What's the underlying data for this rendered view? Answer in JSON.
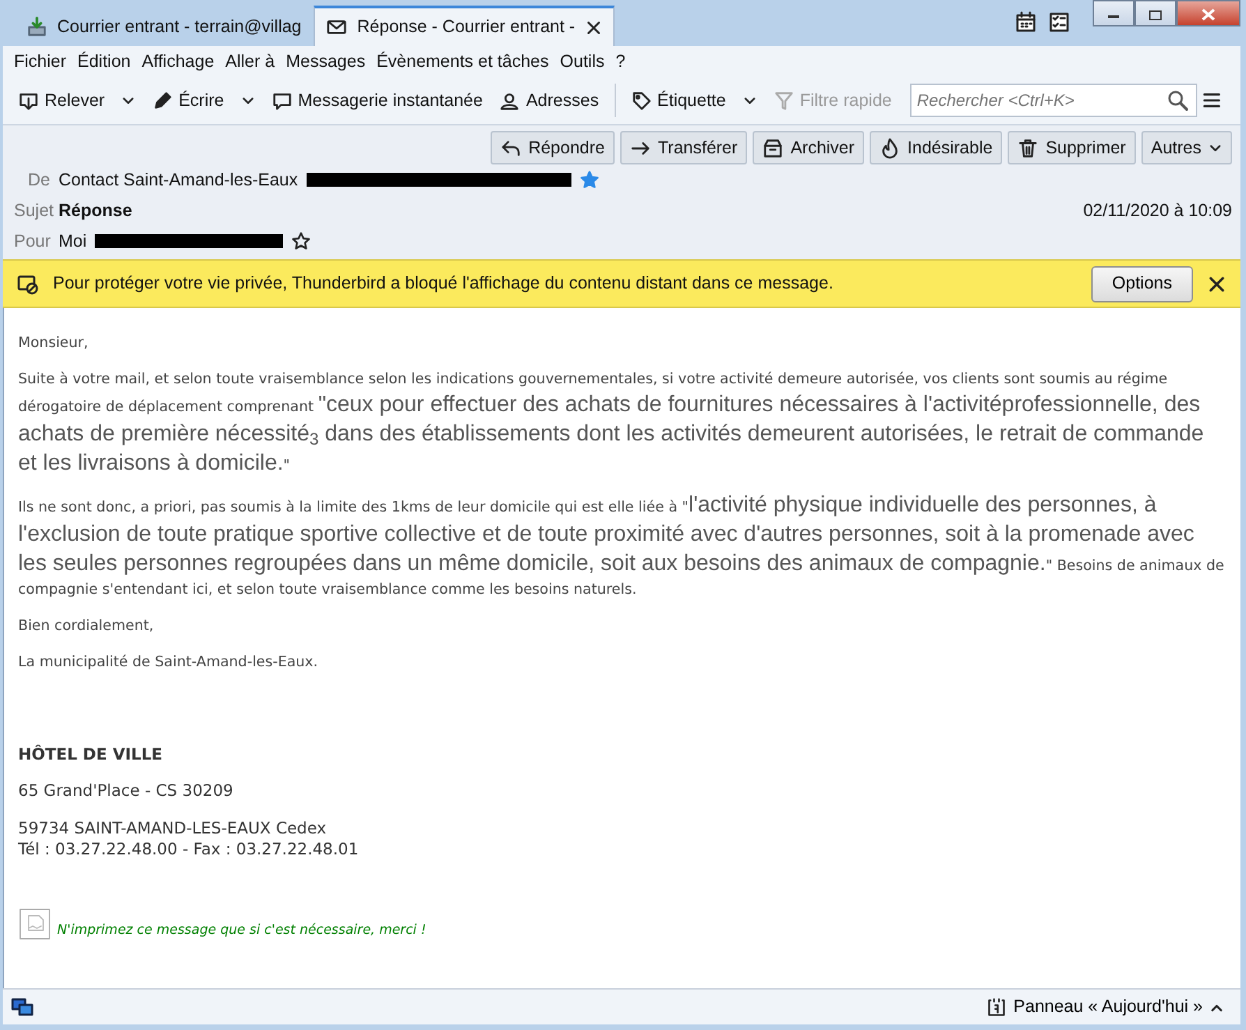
{
  "window": {
    "tabs": [
      {
        "label": "Courrier entrant - terrain@villag",
        "kind": "inbox",
        "selected": false
      },
      {
        "label": "Réponse - Courrier entrant -",
        "kind": "message",
        "selected": true
      }
    ]
  },
  "menu": [
    "Fichier",
    "Édition",
    "Affichage",
    "Aller à",
    "Messages",
    "Évènements et tâches",
    "Outils",
    "?"
  ],
  "toolbar": {
    "buttons": [
      {
        "label": "Relever",
        "kind": "get",
        "dropdown": true,
        "disabled": false
      },
      {
        "label": "Écrire",
        "kind": "write",
        "dropdown": true,
        "disabled": false
      },
      {
        "label": "Messagerie instantanée",
        "kind": "chat",
        "dropdown": false,
        "disabled": false
      },
      {
        "label": "Adresses",
        "kind": "contacts",
        "dropdown": false,
        "disabled": false
      },
      {
        "label": "Étiquette",
        "kind": "tag",
        "dropdown": true,
        "disabled": false
      },
      {
        "label": "Filtre rapide",
        "kind": "filter",
        "dropdown": false,
        "disabled": true
      }
    ],
    "search": {
      "placeholder": "Rechercher <Ctrl+K>"
    }
  },
  "actions": [
    {
      "label": "Répondre",
      "kind": "reply",
      "dropdown": false
    },
    {
      "label": "Transférer",
      "kind": "forward",
      "dropdown": false
    },
    {
      "label": "Archiver",
      "kind": "archive",
      "dropdown": false
    },
    {
      "label": "Indésirable",
      "kind": "junk",
      "dropdown": false
    },
    {
      "label": "Supprimer",
      "kind": "delete",
      "dropdown": false
    },
    {
      "label": "Autres",
      "kind": "more",
      "dropdown": true
    }
  ],
  "header": {
    "fields": [
      {
        "label": "De",
        "value": "Contact Saint-Amand-les-Eaux",
        "kind": "address",
        "redacted": true,
        "starred": true
      },
      {
        "label": "Sujet",
        "value": "Réponse",
        "kind": "subject"
      },
      {
        "label": "Pour",
        "value": "Moi",
        "kind": "address",
        "redacted": true,
        "starred": false
      }
    ],
    "date": "02/11/2020 à 10:09"
  },
  "notification": {
    "text": "Pour protéger votre vie privée, Thunderbird a bloqué l'affichage du contenu distant dans ce message.",
    "button": "Options"
  },
  "body": {
    "paragraphs": [
      {
        "segments": [
          {
            "text": "Monsieur,",
            "kind": "small"
          }
        ]
      },
      {
        "segments": [
          {
            "text": "Suite à votre mail, et selon toute vraisemblance selon les indications gouvernementales, si votre activité demeure autorisée, vos clients sont soumis au régime dérogatoire de déplacement comprenant ",
            "kind": "small"
          },
          {
            "text": "\"ceux pour effectuer des achats de fournitures nécessaires à l'activitéprofessionnelle, des achats de première nécessité$_{3}$ dans des établissements dont les activités demeurent autorisées, le retrait de commande et les livraisons à domicile.",
            "kind": "large"
          },
          {
            "text": "\"",
            "kind": "small"
          }
        ]
      },
      {
        "segments": [
          {
            "text": "Ils ne sont donc, a priori, pas soumis à la limite des 1kms de leur domicile qui est elle liée à \"",
            "kind": "small"
          },
          {
            "text": "l'activité physique individuelle des personnes, à l'exclusion de toute pratique sportive collective et de toute proximité avec d'autres personnes, soit à la promenade avec les seules personnes regroupées dans un même domicile, soit aux besoins des animaux de compagnie.",
            "kind": "large"
          },
          {
            "text": "\" Besoins de animaux de compagnie s'entendant ici, et selon toute vraisemblance comme les besoins naturels.",
            "kind": "small"
          }
        ]
      },
      {
        "segments": [
          {
            "text": "Bien cordialement,",
            "kind": "small"
          }
        ]
      },
      {
        "segments": [
          {
            "text": "La municipalité de Saint-Amand-les-Eaux.",
            "kind": "small"
          }
        ]
      }
    ],
    "signature": {
      "title": "HÔTEL DE VILLE",
      "groups": [
        [
          "65 Grand'Place - CS 30209"
        ],
        [
          "59734 SAINT-AMAND-LES-EAUX Cedex",
          "Tél : 03.27.22.48.00 - Fax : 03.27.22.48.01"
        ]
      ],
      "note": "N'imprimez ce message que si c'est nécessaire, merci !"
    }
  },
  "status_bar": {
    "today_pane": "Panneau « Aujourd'hui »"
  }
}
